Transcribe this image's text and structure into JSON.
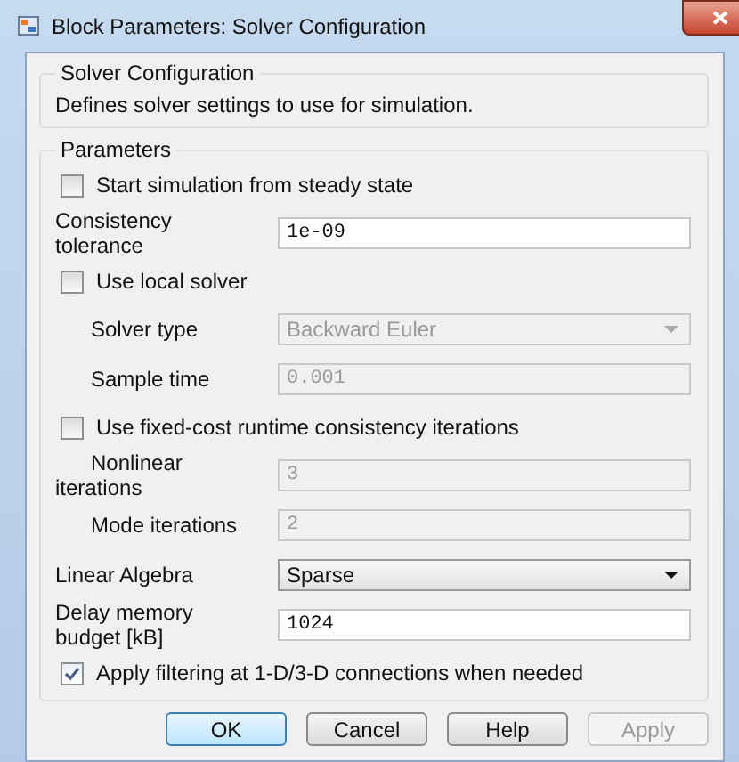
{
  "window": {
    "title": "Block Parameters: Solver Configuration"
  },
  "description_group": {
    "title": "Solver Configuration",
    "text": "Defines solver settings to use for simulation."
  },
  "parameters_group": {
    "title": "Parameters",
    "rows": [
      {
        "kind": "checkbox",
        "label": "Start simulation from steady state",
        "checked": false
      },
      {
        "kind": "text",
        "label": "Consistency tolerance",
        "value": "1e-09",
        "disabled": false,
        "indented": false
      },
      {
        "kind": "checkbox",
        "label": "Use local solver",
        "checked": false
      },
      {
        "kind": "dropdown",
        "label": "Solver type",
        "value": "Backward Euler",
        "disabled": true,
        "indented": true
      },
      {
        "kind": "text",
        "label": "Sample time",
        "value": "0.001",
        "disabled": true,
        "indented": true
      },
      {
        "kind": "checkbox",
        "label": "Use fixed-cost runtime consistency iterations",
        "checked": false
      },
      {
        "kind": "text",
        "label": "Nonlinear iterations",
        "value": "3",
        "disabled": true,
        "indented": true
      },
      {
        "kind": "text",
        "label": "Mode iterations",
        "value": "2",
        "disabled": true,
        "indented": true
      },
      {
        "kind": "dropdown",
        "label": "Linear Algebra",
        "value": "Sparse",
        "disabled": false,
        "indented": false
      },
      {
        "kind": "text",
        "label": "Delay memory budget [kB]",
        "value": "1024",
        "disabled": false,
        "indented": false
      },
      {
        "kind": "checkbox",
        "label": "Apply filtering at 1-D/3-D connections when needed",
        "checked": true
      }
    ]
  },
  "buttons": [
    {
      "label": "OK",
      "default": true,
      "disabled": false
    },
    {
      "label": "Cancel",
      "default": false,
      "disabled": false
    },
    {
      "label": "Help",
      "default": false,
      "disabled": false
    },
    {
      "label": "Apply",
      "default": false,
      "disabled": true
    }
  ]
}
